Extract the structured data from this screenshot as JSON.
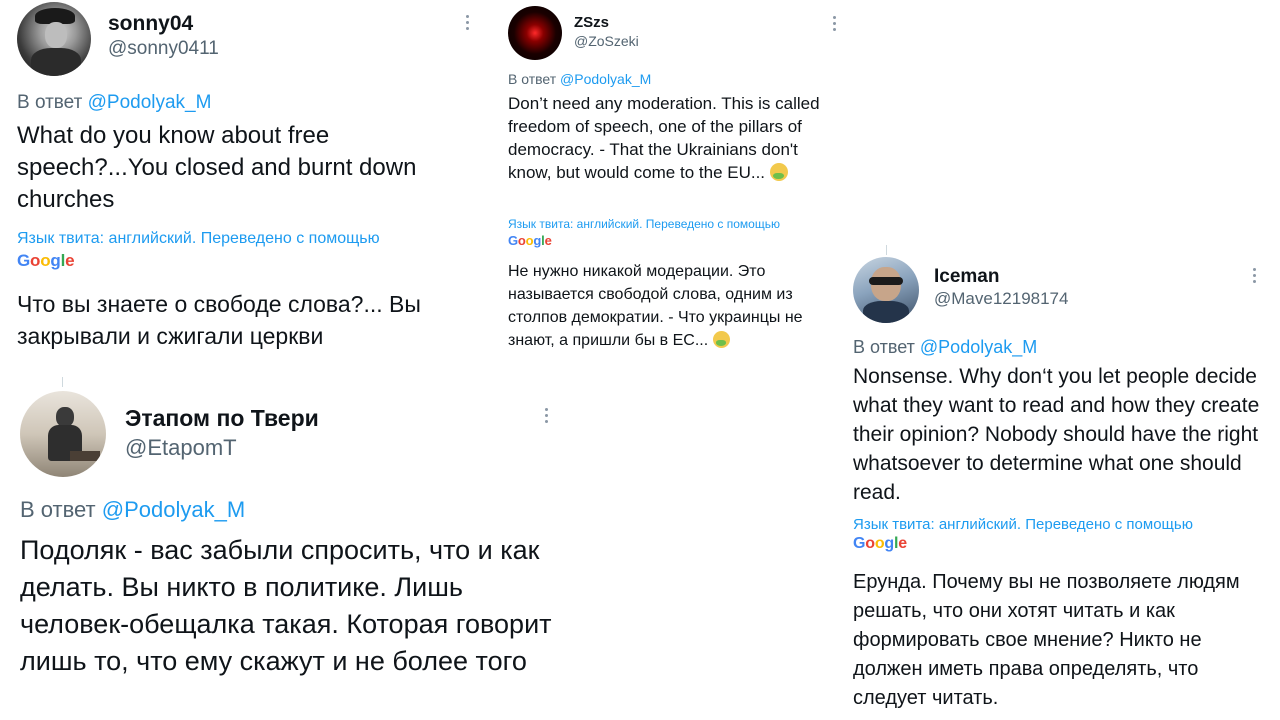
{
  "tweets": [
    {
      "name": "sonny04",
      "handle": "@sonny0411",
      "reply_prefix": "В ответ",
      "reply_to": "@Podolyak_M",
      "text": "What do you know about free speech?...You closed and burnt down churches",
      "translation_note": "Язык твита: английский. Переведено с помощью",
      "translator": "Google",
      "translated": "Что вы знаете о свободе слова?... Вы закрывали и сжигали церкви"
    },
    {
      "name": "ZSzs",
      "handle": "@ZoSzeki",
      "reply_prefix": "В ответ",
      "reply_to": "@Podolyak_M",
      "text": "Don’t need any moderation. This is called freedom of speech, one of the pillars of democracy.  - That the Ukrainians don't know, but would come to the EU...",
      "translation_note": "Язык твита: английский. Переведено с помощью",
      "translator": "Google",
      "translated": "Не нужно никакой модерации. Это называется свободой слова, одним из столпов демократии. - Что украинцы не знают, а пришли бы в ЕС...",
      "emoji": "nauseated-face"
    },
    {
      "name": "Iceman",
      "handle": "@Mave12198174",
      "reply_prefix": "В ответ",
      "reply_to": "@Podolyak_M",
      "text": "Nonsense. Why don‘t you let people decide what they want to read and how they create their opinion? Nobody should have the right whatsoever to determine what one should read.",
      "translation_note": "Язык твита: английский. Переведено с помощью",
      "translator": "Google",
      "translated": "Ерунда. Почему вы не позволяете людям решать, что они хотят читать и как формировать свое мнение? Никто не должен иметь права определять, что следует читать."
    },
    {
      "name": "Этапом по Твери",
      "handle": "@EtapomT",
      "reply_prefix": "В ответ",
      "reply_to": "@Podolyak_M",
      "text": "Подоляк - вас забыли спросить, что и как делать. Вы никто в политике. Лишь человек-обещалка такая. Которая говорит лишь то, что ему скажут и не более того"
    }
  ],
  "colors": {
    "link": "#1d9bf0",
    "muted": "#536471",
    "text": "#0f1419"
  }
}
